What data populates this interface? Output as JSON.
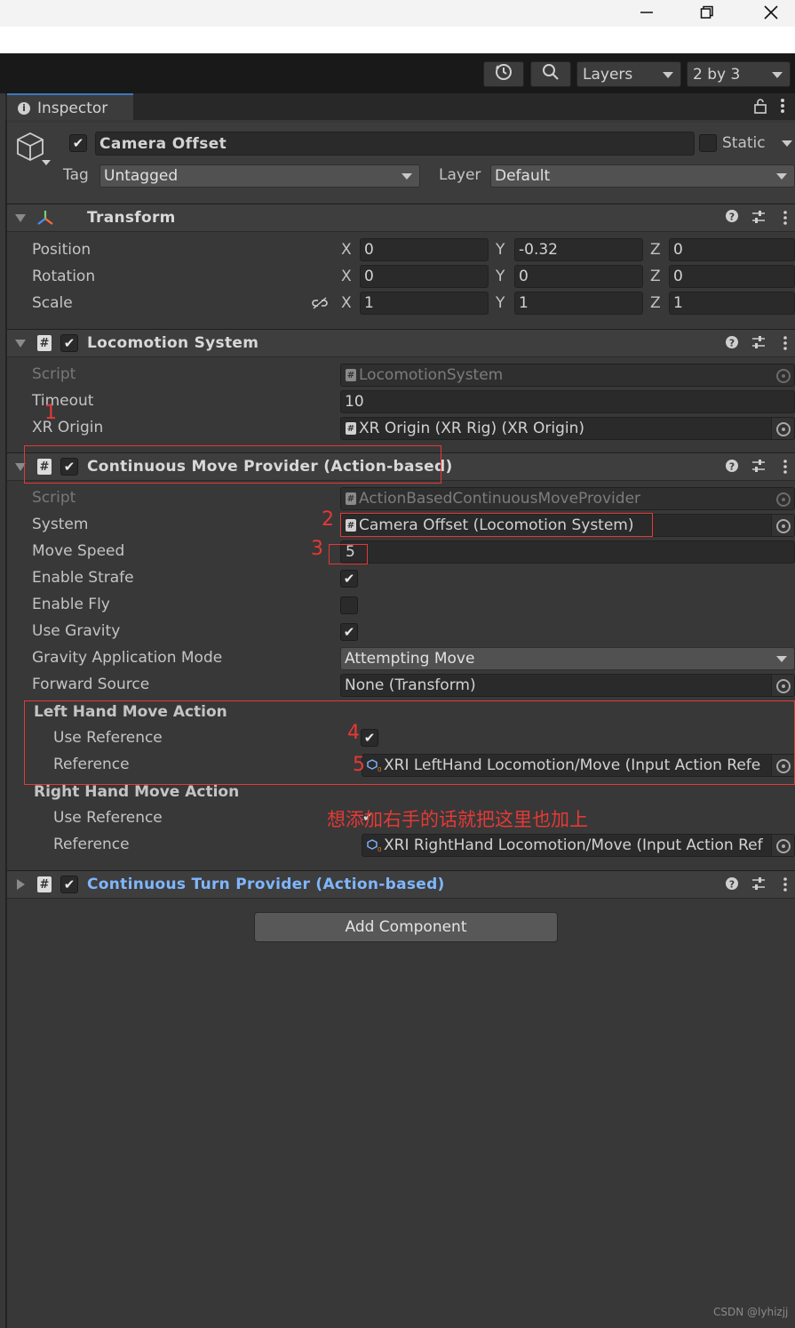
{
  "window": {
    "minimize_icon": "minimize-icon",
    "restore_icon": "restore-icon",
    "close_icon": "close-icon"
  },
  "toolbar": {
    "layers_label": "Layers",
    "layout_label": "2 by 3"
  },
  "tab": {
    "label": "Inspector"
  },
  "gameobject": {
    "name": "Camera Offset",
    "static_label": "Static",
    "tag_label": "Tag",
    "tag_value": "Untagged",
    "layer_label": "Layer",
    "layer_value": "Default"
  },
  "transform": {
    "title": "Transform",
    "rows": [
      {
        "label": "Position",
        "x": "0",
        "y": "-0.32",
        "z": "0"
      },
      {
        "label": "Rotation",
        "x": "0",
        "y": "0",
        "z": "0"
      },
      {
        "label": "Scale",
        "x": "1",
        "y": "1",
        "z": "1"
      }
    ],
    "axis_x": "X",
    "axis_y": "Y",
    "axis_z": "Z"
  },
  "locomotion": {
    "title": "Locomotion System",
    "script_label": "Script",
    "script_value": "LocomotionSystem",
    "timeout_label": "Timeout",
    "timeout_value": "10",
    "xr_origin_label": "XR Origin",
    "xr_origin_value": "XR Origin (XR Rig) (XR Origin)"
  },
  "move_provider": {
    "title": "Continuous Move Provider (Action-based)",
    "script_label": "Script",
    "script_value": "ActionBasedContinuousMoveProvider",
    "system_label": "System",
    "system_value": "Camera Offset (Locomotion System)",
    "speed_label": "Move Speed",
    "speed_value": "5",
    "strafe_label": "Enable Strafe",
    "strafe_checked": true,
    "fly_label": "Enable Fly",
    "fly_checked": false,
    "gravity_label": "Use Gravity",
    "gravity_checked": true,
    "gravity_mode_label": "Gravity Application Mode",
    "gravity_mode_value": "Attempting Move",
    "forward_label": "Forward Source",
    "forward_value": "None (Transform)",
    "left_header": "Left Hand Move Action",
    "left_use_ref_label": "Use Reference",
    "left_ref_label": "Reference",
    "left_ref_value": "XRI LeftHand Locomotion/Move (Input Action Refe",
    "right_header": "Right Hand Move Action",
    "right_use_ref_label": "Use Reference",
    "right_ref_label": "Reference",
    "right_ref_value": "XRI RightHand Locomotion/Move (Input Action Ref"
  },
  "turn_provider": {
    "title": "Continuous Turn Provider (Action-based)"
  },
  "add_component_label": "Add Component",
  "annotations": {
    "n1": "1",
    "n2": "2",
    "n3": "3",
    "n4": "4",
    "n5": "5",
    "note": "想添加右手的话就把这里也加上"
  },
  "watermark": "CSDN @lyhizjj",
  "colors": {
    "accent_tab": "#3a79bb",
    "annotation_red": "#e53935",
    "link_blue": "#7fb6ff"
  }
}
